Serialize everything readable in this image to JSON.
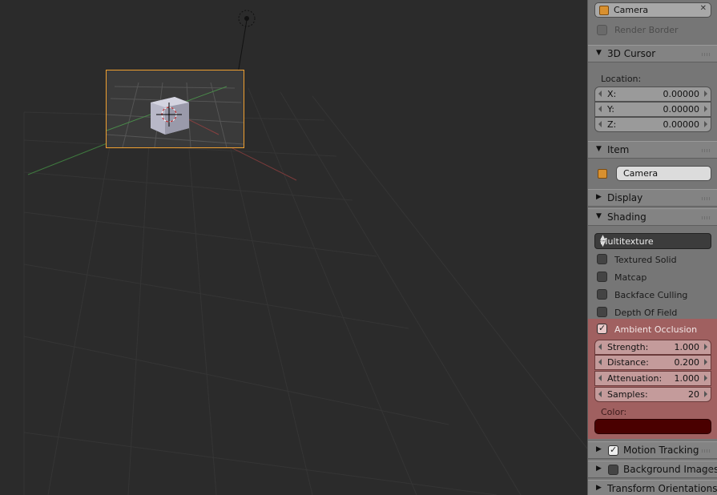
{
  "panel": {
    "camera_field": "Camera",
    "render_border": "Render Border",
    "cursor": {
      "title": "3D Cursor",
      "location_label": "Location:",
      "x_label": "X:",
      "x_value": "0.00000",
      "y_label": "Y:",
      "y_value": "0.00000",
      "z_label": "Z:",
      "z_value": "0.00000"
    },
    "item": {
      "title": "Item",
      "name": "Camera"
    },
    "display": {
      "title": "Display"
    },
    "shading": {
      "title": "Shading",
      "mode": "Multitexture",
      "textured_solid": "Textured Solid",
      "matcap": "Matcap",
      "backface_culling": "Backface Culling",
      "depth_of_field": "Depth Of Field",
      "ambient_occlusion": "Ambient Occlusion",
      "strength_label": "Strength:",
      "strength_value": "1.000",
      "distance_label": "Distance:",
      "distance_value": "0.200",
      "attenuation_label": "Attenuation:",
      "attenuation_value": "1.000",
      "samples_label": "Samples:",
      "samples_value": "20",
      "color_label": "Color:",
      "color": "#4a0000"
    },
    "motion_tracking": {
      "title": "Motion Tracking"
    },
    "background_images": {
      "title": "Background Images"
    },
    "transform_orientations": {
      "title": "Transform Orientations"
    }
  },
  "colors": {
    "viewport_bg": "#2b2b2b",
    "panel_bg": "#767676",
    "selection": "#f0a030",
    "ao_highlight": "#a06060"
  }
}
